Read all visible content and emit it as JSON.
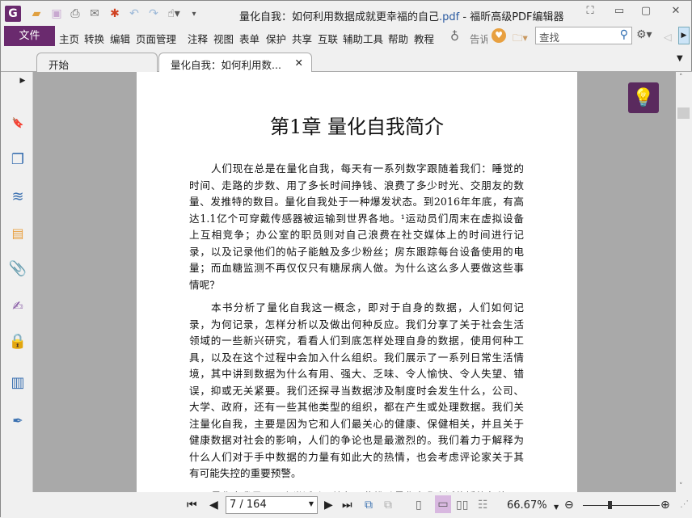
{
  "window": {
    "title_doc": "量化自我：如何利用数据成就更幸福的自己",
    "title_ext": ".pdf",
    "title_app": " - 福昕高级PDF编辑器"
  },
  "menu": {
    "file": "文件",
    "items": [
      "主页",
      "转换",
      "编辑",
      "页面管理",
      "注释",
      "视图",
      "表单",
      "保护",
      "共享",
      "互联",
      "辅助工具",
      "帮助",
      "教程"
    ],
    "tell": "告诉"
  },
  "search": {
    "placeholder": "查找"
  },
  "tabs": [
    {
      "label": "开始"
    },
    {
      "label": "量化自我：如何利用数..."
    }
  ],
  "document": {
    "chapter": "第1章 量化自我简介",
    "paragraphs": [
      [
        "人们现在总是在量化自我，每天有一系列数字跟随着我们：睡觉的",
        "时间、走路的步数、用了多长时间挣钱、浪费了多少时光、交朋友的数",
        "量、发推特的数目。量化自我处于一种爆发状态。到2016年年底，有高",
        "达1.1亿个可穿戴传感器被运输到世界各地。¹运动员们周末在虚拟设备",
        "上互相竞争；办公室的职员则对自己浪费在社交媒体上的时间进行记",
        "录，以及记录他们的帖子能触及多少粉丝；房东跟踪每台设备使用的电",
        "量；而血糖监测不再仅仅只有糖尿病人做。为什么这么多人要做这些事",
        "情呢？"
      ],
      [
        "本书分析了量化自我这一概念，即对于自身的数据，人们如何记",
        "录，为何记录，怎样分析以及做出何种反应。我们分享了关于社会生活",
        "领域的一些新兴研究，看看人们到底怎样处理自身的数据，使用何种工",
        "具，以及在这个过程中会加入什么组织。我们展示了一系列日常生活情",
        "境，其中讲到数据为什么有用、强大、乏味、令人愉快、令人失望、错",
        "误，抑或无关紧要。我们还探寻当数据涉及制度时会发生什么，公司、",
        "大学、政府，还有一些其他类型的组织，都在产生或处理数据。我们关",
        "注量化自我，主要是因为它和人们最关心的健康、保健相关，并且关于",
        "健康数据对社会的影响，人们的争论也是最激烈的。我们着力于解释为",
        "什么人们对于手中数据的力量有如此大的热情，也会考虑评论家关于其",
        "有可能失控的重要预警。"
      ],
      [
        "量化自我是一项人类活动，比起那些推动量化自我广泛传播的各种"
      ]
    ]
  },
  "status": {
    "page": "7 / 164",
    "zoom": "66.67%",
    "zoom_fraction": 0.35
  },
  "colors": {
    "brand": "#6a2a6e",
    "accent": "#2a5aa0"
  }
}
